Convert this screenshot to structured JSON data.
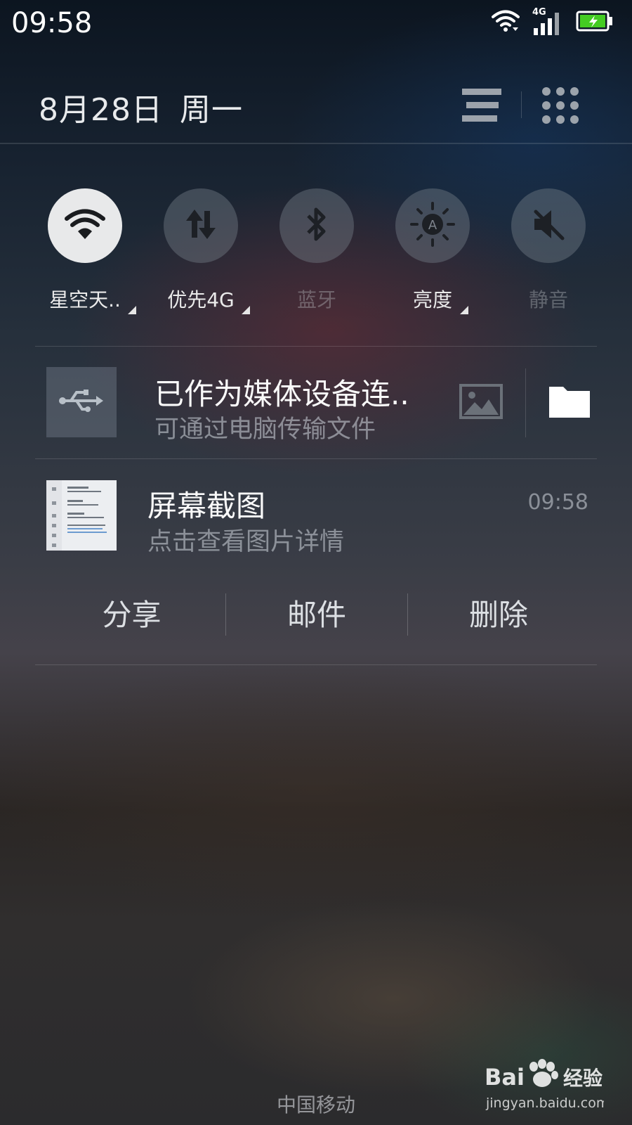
{
  "status_bar": {
    "time": "09:58",
    "network_type": "4G",
    "icons": [
      "wifi-icon",
      "signal-icon",
      "battery-charging-icon"
    ],
    "battery_color": "#44cc22"
  },
  "header": {
    "date": "8月28日",
    "weekday": "周一",
    "icons": [
      "list-icon",
      "apps-grid-icon"
    ]
  },
  "toggles": [
    {
      "label": "星空天..",
      "icon": "wifi-icon",
      "active": true,
      "has_menu": true
    },
    {
      "label": "优先4G",
      "icon": "data-transfer-icon",
      "active": false,
      "has_menu": true
    },
    {
      "label": "蓝牙",
      "icon": "bluetooth-icon",
      "active": false,
      "has_menu": false
    },
    {
      "label": "亮度",
      "icon": "auto-brightness-icon",
      "active": false,
      "has_menu": true
    },
    {
      "label": "静音",
      "icon": "mute-icon",
      "active": false,
      "has_menu": false
    }
  ],
  "notifications": [
    {
      "icon": "usb-icon",
      "title": "已作为媒体设备连..",
      "subtitle": "可通过电脑传输文件",
      "actions": [
        "image-icon",
        "folder-icon"
      ]
    },
    {
      "icon": "screenshot-thumbnail",
      "title": "屏幕截图",
      "subtitle": "点击查看图片详情",
      "time": "09:58",
      "actions": [
        "分享",
        "邮件",
        "删除"
      ]
    }
  ],
  "footer": {
    "carrier": "中国移动",
    "watermark_text": "Bai经验",
    "watermark_url": "jingyan.baidu.com"
  }
}
